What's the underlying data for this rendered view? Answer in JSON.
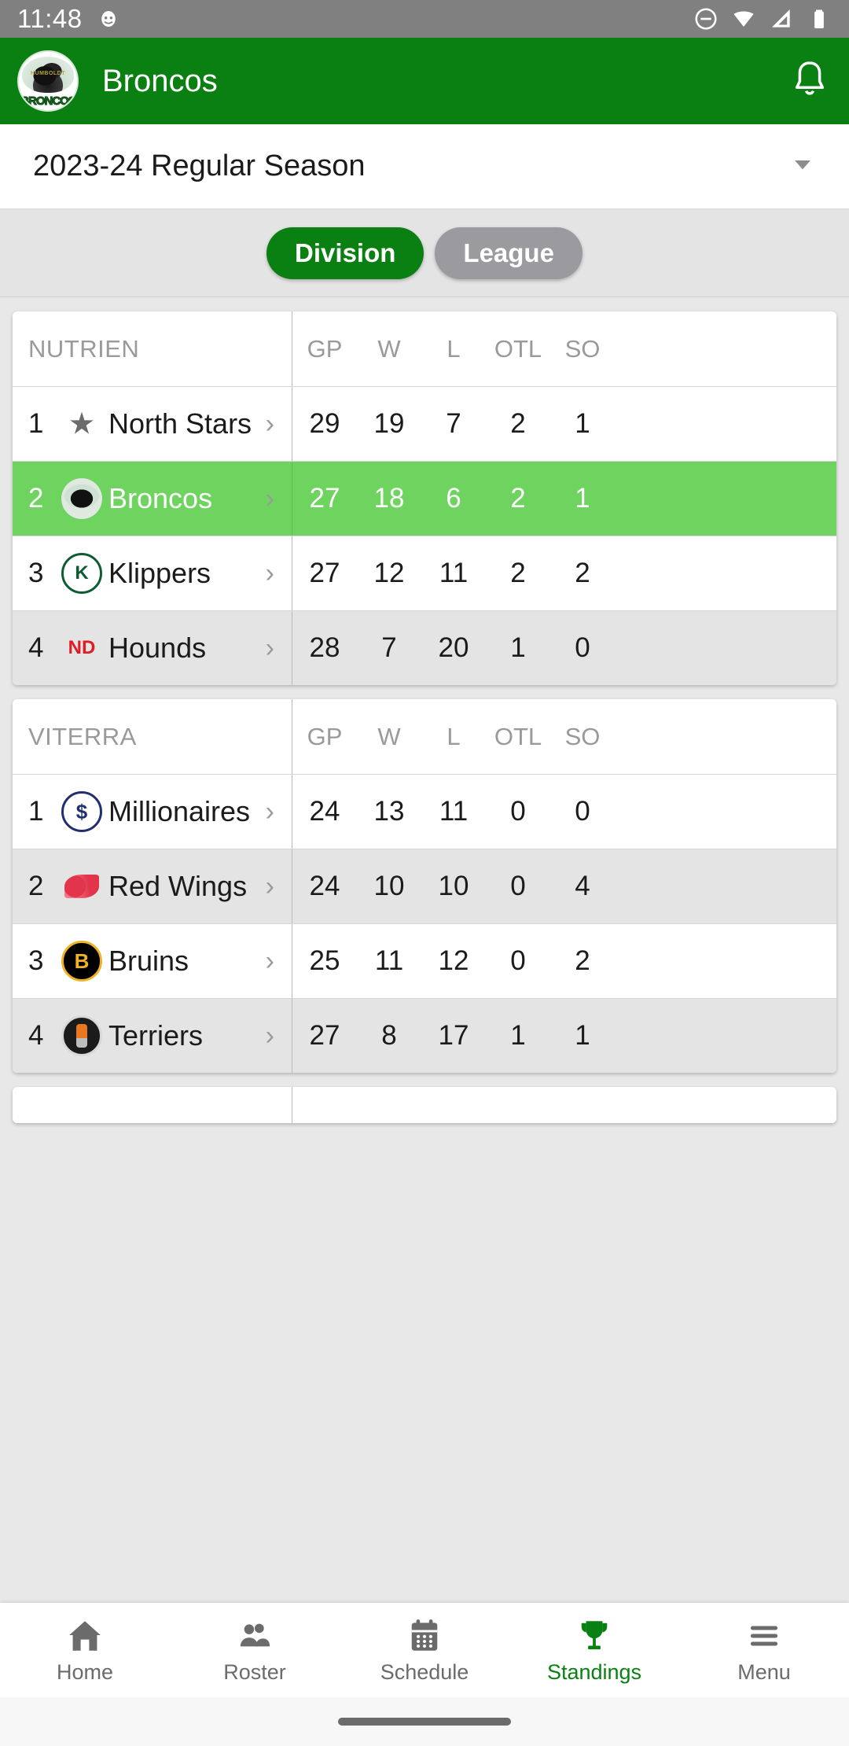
{
  "status_bar": {
    "time": "11:48",
    "icons": [
      "dnd-icon",
      "wifi-icon",
      "cellular-signal-icon",
      "battery-icon"
    ]
  },
  "app_bar": {
    "title": "Broncos",
    "logo_text": "BRONCOS",
    "logo_top_text": "HUMBOLDT",
    "notification_icon": "bell-icon"
  },
  "season_selector": {
    "value": "2023-24 Regular Season",
    "caret_icon": "chevron-down-icon"
  },
  "scope_toggle": {
    "division_label": "Division",
    "league_label": "League",
    "active": "Division",
    "active_color": "#0a8012",
    "inactive_color": "#9a9a9f"
  },
  "standings": {
    "columns": [
      "GP",
      "W",
      "L",
      "OTL",
      "SO"
    ],
    "highlight_color": "#6fd35f",
    "divisions": [
      {
        "name": "NUTRIEN",
        "teams": [
          {
            "rank": "1",
            "name": "North Stars",
            "logo": "stars-logo-icon",
            "gp": "29",
            "w": "19",
            "l": "7",
            "otl": "2",
            "so": "1",
            "highlight": false
          },
          {
            "rank": "2",
            "name": "Broncos",
            "logo": "broncos-logo-icon",
            "gp": "27",
            "w": "18",
            "l": "6",
            "otl": "2",
            "so": "1",
            "highlight": true
          },
          {
            "rank": "3",
            "name": "Klippers",
            "logo": "klippers-logo-icon",
            "gp": "27",
            "w": "12",
            "l": "11",
            "otl": "2",
            "so": "2",
            "highlight": false
          },
          {
            "rank": "4",
            "name": "Hounds",
            "logo": "hounds-logo-icon",
            "gp": "28",
            "w": "7",
            "l": "20",
            "otl": "1",
            "so": "0",
            "highlight": false
          }
        ]
      },
      {
        "name": "VITERRA",
        "teams": [
          {
            "rank": "1",
            "name": "Millionaires",
            "logo": "millionaires-logo-icon",
            "gp": "24",
            "w": "13",
            "l": "11",
            "otl": "0",
            "so": "0",
            "highlight": false
          },
          {
            "rank": "2",
            "name": "Red Wings",
            "logo": "redwings-logo-icon",
            "gp": "24",
            "w": "10",
            "l": "10",
            "otl": "0",
            "so": "4",
            "highlight": false
          },
          {
            "rank": "3",
            "name": "Bruins",
            "logo": "bruins-logo-icon",
            "gp": "25",
            "w": "11",
            "l": "12",
            "otl": "0",
            "so": "2",
            "highlight": false
          },
          {
            "rank": "4",
            "name": "Terriers",
            "logo": "terriers-logo-icon",
            "gp": "27",
            "w": "8",
            "l": "17",
            "otl": "1",
            "so": "1",
            "highlight": false
          }
        ]
      }
    ],
    "row_chevron_icon": "chevron-right-icon"
  },
  "bottom_nav": {
    "active": "Standings",
    "active_color": "#0a8012",
    "items": [
      {
        "label": "Home",
        "icon": "home-icon"
      },
      {
        "label": "Roster",
        "icon": "people-icon"
      },
      {
        "label": "Schedule",
        "icon": "calendar-icon"
      },
      {
        "label": "Standings",
        "icon": "trophy-icon"
      },
      {
        "label": "Menu",
        "icon": "hamburger-menu-icon"
      }
    ]
  }
}
